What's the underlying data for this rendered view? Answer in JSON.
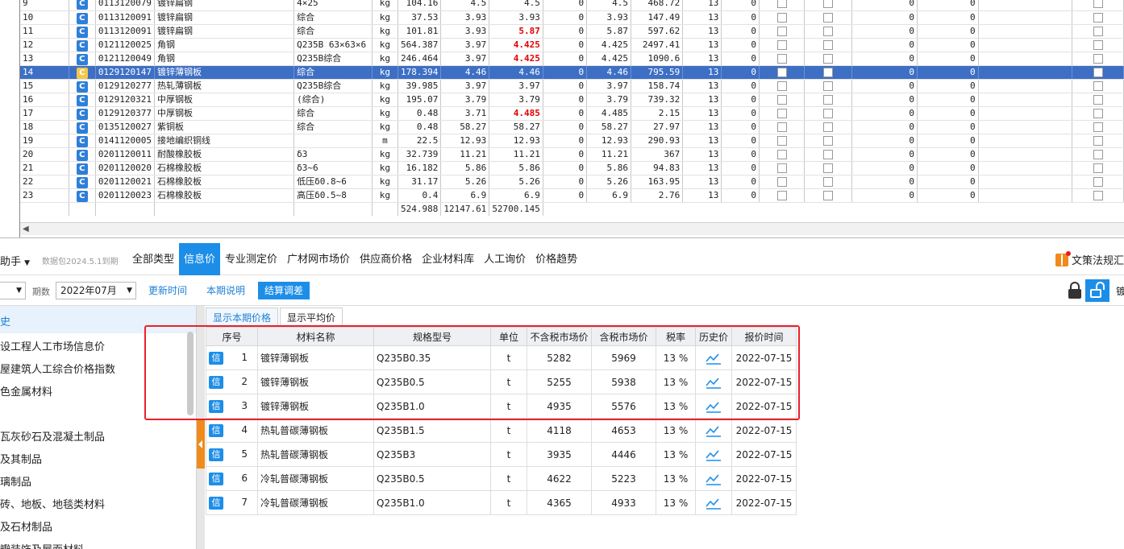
{
  "sheet": {
    "rows": [
      {
        "no": "9",
        "code": "0113120079",
        "name": "镀锌扁钢",
        "spec": "4×25",
        "unit": "kg",
        "qty": "104.16",
        "p1": "4.5",
        "p2": "4.5",
        "red": false,
        "z1": "0",
        "p3": "4.5",
        "amt": "468.72",
        "t": "13",
        "z2": "0",
        "z3": "0",
        "z4": "0"
      },
      {
        "no": "10",
        "code": "0113120091",
        "name": "镀锌扁钢",
        "spec": "综合",
        "unit": "kg",
        "qty": "37.53",
        "p1": "3.93",
        "p2": "3.93",
        "red": false,
        "z1": "0",
        "p3": "3.93",
        "amt": "147.49",
        "t": "13",
        "z2": "0",
        "z3": "0",
        "z4": "0"
      },
      {
        "no": "11",
        "code": "0113120091",
        "name": "镀锌扁钢",
        "spec": "综合",
        "unit": "kg",
        "qty": "101.81",
        "p1": "3.93",
        "p2": "5.87",
        "red": true,
        "z1": "0",
        "p3": "5.87",
        "amt": "597.62",
        "t": "13",
        "z2": "0",
        "z3": "0",
        "z4": "0"
      },
      {
        "no": "12",
        "code": "0121120025",
        "name": "角钢",
        "spec": "Q235B 63×63×6",
        "unit": "kg",
        "qty": "564.387",
        "p1": "3.97",
        "p2": "4.425",
        "red": true,
        "z1": "0",
        "p3": "4.425",
        "amt": "2497.41",
        "t": "13",
        "z2": "0",
        "z3": "0",
        "z4": "0"
      },
      {
        "no": "13",
        "code": "0121120049",
        "name": "角钢",
        "spec": "Q235B综合",
        "unit": "kg",
        "qty": "246.464",
        "p1": "3.97",
        "p2": "4.425",
        "red": true,
        "z1": "0",
        "p3": "4.425",
        "amt": "1090.6",
        "t": "13",
        "z2": "0",
        "z3": "0",
        "z4": "0"
      },
      {
        "no": "14",
        "code": "0129120147",
        "name": "镀锌薄钢板",
        "spec": "综合",
        "unit": "kg",
        "qty": "178.394",
        "p1": "4.46",
        "p2": "4.46",
        "red": false,
        "z1": "0",
        "p3": "4.46",
        "amt": "795.59",
        "t": "13",
        "z2": "0",
        "z3": "0",
        "z4": "0",
        "selected": true
      },
      {
        "no": "15",
        "code": "0129120277",
        "name": "热轧薄钢板",
        "spec": "Q235B综合",
        "unit": "kg",
        "qty": "39.985",
        "p1": "3.97",
        "p2": "3.97",
        "red": false,
        "z1": "0",
        "p3": "3.97",
        "amt": "158.74",
        "t": "13",
        "z2": "0",
        "z3": "0",
        "z4": "0"
      },
      {
        "no": "16",
        "code": "0129120321",
        "name": "中厚钢板",
        "spec": "(综合)",
        "unit": "kg",
        "qty": "195.07",
        "p1": "3.79",
        "p2": "3.79",
        "red": false,
        "z1": "0",
        "p3": "3.79",
        "amt": "739.32",
        "t": "13",
        "z2": "0",
        "z3": "0",
        "z4": "0"
      },
      {
        "no": "17",
        "code": "0129120377",
        "name": "中厚钢板",
        "spec": "综合",
        "unit": "kg",
        "qty": "0.48",
        "p1": "3.71",
        "p2": "4.485",
        "red": true,
        "z1": "0",
        "p3": "4.485",
        "amt": "2.15",
        "t": "13",
        "z2": "0",
        "z3": "0",
        "z4": "0"
      },
      {
        "no": "18",
        "code": "0135120027",
        "name": "紫铜板",
        "spec": "综合",
        "unit": "kg",
        "qty": "0.48",
        "p1": "58.27",
        "p2": "58.27",
        "red": false,
        "z1": "0",
        "p3": "58.27",
        "amt": "27.97",
        "t": "13",
        "z2": "0",
        "z3": "0",
        "z4": "0"
      },
      {
        "no": "19",
        "code": "0141120005",
        "name": "接地编织铜线",
        "spec": "",
        "unit": "m",
        "qty": "22.5",
        "p1": "12.93",
        "p2": "12.93",
        "red": false,
        "z1": "0",
        "p3": "12.93",
        "amt": "290.93",
        "t": "13",
        "z2": "0",
        "z3": "0",
        "z4": "0"
      },
      {
        "no": "20",
        "code": "0201120011",
        "name": "耐酸橡胶板",
        "spec": "δ3",
        "unit": "kg",
        "qty": "32.739",
        "p1": "11.21",
        "p2": "11.21",
        "red": false,
        "z1": "0",
        "p3": "11.21",
        "amt": "367",
        "t": "13",
        "z2": "0",
        "z3": "0",
        "z4": "0"
      },
      {
        "no": "21",
        "code": "0201120020",
        "name": "石棉橡胶板",
        "spec": "δ3~6",
        "unit": "kg",
        "qty": "16.182",
        "p1": "5.86",
        "p2": "5.86",
        "red": false,
        "z1": "0",
        "p3": "5.86",
        "amt": "94.83",
        "t": "13",
        "z2": "0",
        "z3": "0",
        "z4": "0"
      },
      {
        "no": "22",
        "code": "0201120021",
        "name": "石棉橡胶板",
        "spec": "低压δ0.8~6",
        "unit": "kg",
        "qty": "31.17",
        "p1": "5.26",
        "p2": "5.26",
        "red": false,
        "z1": "0",
        "p3": "5.26",
        "amt": "163.95",
        "t": "13",
        "z2": "0",
        "z3": "0",
        "z4": "0"
      },
      {
        "no": "23",
        "code": "0201120023",
        "name": "石棉橡胶板",
        "spec": "高压δ0.5~8",
        "unit": "kg",
        "qty": "0.4",
        "p1": "6.9",
        "p2": "6.9",
        "red": false,
        "z1": "0",
        "p3": "6.9",
        "amt": "2.76",
        "t": "13",
        "z2": "0",
        "z3": "0",
        "z4": "0"
      }
    ],
    "totals": {
      "qty": "524.988",
      "p1": "12147.61",
      "p2": "52700.145"
    }
  },
  "tabbar": {
    "assistant": "助手",
    "package": "数据包2024.5.1到期",
    "tabs": [
      "全部类型",
      "信息价",
      "专业测定价",
      "广材网市场价",
      "供应商价格",
      "企业材料库",
      "人工询价",
      "价格趋势"
    ],
    "law": "文策法规汇"
  },
  "filter": {
    "period_label": "期数",
    "period_value": "2022年07月",
    "update_time": "更新时间",
    "period_note": "本期说明",
    "settlement": "结算调差",
    "cut_text": "镀"
  },
  "categories": {
    "header": "史",
    "items": [
      "设工程人工市场信息价",
      "屋建筑人工综合价格指数",
      "色金属材料",
      "瓦灰砂石及混凝土制品",
      "及其制品",
      "璃制品",
      "砖、地板、地毯类材料",
      "及石材制品",
      "瓣装饰及屋面材料"
    ]
  },
  "price": {
    "subtabs": [
      "显示本期价格",
      "显示平均价"
    ],
    "headers": [
      "序号",
      "材料名称",
      "规格型号",
      "单位",
      "不含税市场价",
      "含税市场价",
      "税率",
      "历史价",
      "报价时间"
    ],
    "badge": "信",
    "rows": [
      {
        "no": "1",
        "name": "镀锌薄钢板",
        "spec": "Q235B0.35",
        "unit": "t",
        "ex": "5282",
        "inc": "5969",
        "rate": "13 %",
        "date": "2022-07-15"
      },
      {
        "no": "2",
        "name": "镀锌薄钢板",
        "spec": "Q235B0.5",
        "unit": "t",
        "ex": "5255",
        "inc": "5938",
        "rate": "13 %",
        "date": "2022-07-15"
      },
      {
        "no": "3",
        "name": "镀锌薄钢板",
        "spec": "Q235B1.0",
        "unit": "t",
        "ex": "4935",
        "inc": "5576",
        "rate": "13 %",
        "date": "2022-07-15"
      },
      {
        "no": "4",
        "name": "热轧普碳薄钢板",
        "spec": "Q235B1.5",
        "unit": "t",
        "ex": "4118",
        "inc": "4653",
        "rate": "13 %",
        "date": "2022-07-15"
      },
      {
        "no": "5",
        "name": "热轧普碳薄钢板",
        "spec": "Q235B3",
        "unit": "t",
        "ex": "3935",
        "inc": "4446",
        "rate": "13 %",
        "date": "2022-07-15"
      },
      {
        "no": "6",
        "name": "冷轧普碳薄钢板",
        "spec": "Q235B0.5",
        "unit": "t",
        "ex": "4622",
        "inc": "5223",
        "rate": "13 %",
        "date": "2022-07-15"
      },
      {
        "no": "7",
        "name": "冷轧普碳薄钢板",
        "spec": "Q235B1.0",
        "unit": "t",
        "ex": "4365",
        "inc": "4933",
        "rate": "13 %",
        "date": "2022-07-15"
      }
    ]
  },
  "colors": {
    "accent": "#1d8ee8",
    "selected_row": "#3d6fc4",
    "highlight": "#e8222a",
    "warn_price": "#e00000",
    "handle": "#f08a1c"
  }
}
